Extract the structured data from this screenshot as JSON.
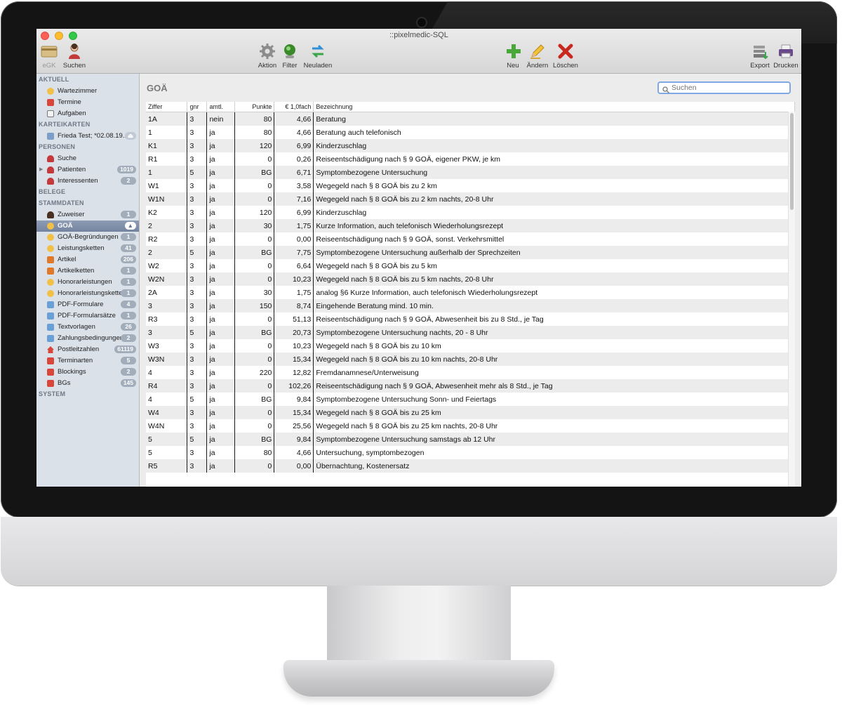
{
  "window": {
    "title": "::pixelmedic-SQL"
  },
  "toolbar": {
    "egk": "eGK",
    "search": "Suchen",
    "action": "Aktion",
    "filter": "Filter",
    "reload": "Neuladen",
    "new": "Neu",
    "edit": "Ändern",
    "delete": "Löschen",
    "export": "Export",
    "print": "Drucken"
  },
  "sidebar": {
    "sections": [
      "AKTUELL",
      "KARTEIKARTEN",
      "PERSONEN",
      "BELEGE",
      "STAMMDATEN",
      "SYSTEM"
    ],
    "items": [
      {
        "label": "Wartezimmer",
        "badge": ""
      },
      {
        "label": "Termine",
        "badge": ""
      },
      {
        "label": "Aufgaben",
        "badge": ""
      },
      {
        "label": "Frieda Test; *02.08.19...",
        "badge": ""
      },
      {
        "label": "Suche",
        "badge": ""
      },
      {
        "label": "Patienten",
        "badge": "1019"
      },
      {
        "label": "Interessenten",
        "badge": "2"
      },
      {
        "label": "Zuweiser",
        "badge": "1"
      },
      {
        "label": "GOÄ",
        "badge": "▲"
      },
      {
        "label": "GOÄ-Begründungen",
        "badge": "1"
      },
      {
        "label": "Leistungsketten",
        "badge": "41"
      },
      {
        "label": "Artikel",
        "badge": "206"
      },
      {
        "label": "Artikelketten",
        "badge": "1"
      },
      {
        "label": "Honorarleistungen",
        "badge": "1"
      },
      {
        "label": "Honorarleistungsketten",
        "badge": "1"
      },
      {
        "label": "PDF-Formulare",
        "badge": "4"
      },
      {
        "label": "PDF-Formularsätze",
        "badge": "1"
      },
      {
        "label": "Textvorlagen",
        "badge": "26"
      },
      {
        "label": "Zahlungsbedingungen",
        "badge": "2"
      },
      {
        "label": "Postleitzahlen",
        "badge": "61119"
      },
      {
        "label": "Terminarten",
        "badge": "5"
      },
      {
        "label": "Blockings",
        "badge": "2"
      },
      {
        "label": "BGs",
        "badge": "145"
      }
    ]
  },
  "main": {
    "title": "GOÄ",
    "search_placeholder": "Suchen",
    "columns": [
      "Ziffer",
      "gnr",
      "amtl.",
      "Punkte",
      "€ 1,0fach",
      "Bezeichnung"
    ],
    "rows": [
      [
        "1A",
        "3",
        "nein",
        "80",
        "4,66",
        "Beratung"
      ],
      [
        "1",
        "3",
        "ja",
        "80",
        "4,66",
        "Beratung auch telefonisch"
      ],
      [
        "K1",
        "3",
        "ja",
        "120",
        "6,99",
        "Kinderzuschlag"
      ],
      [
        "R1",
        "3",
        "ja",
        "0",
        "0,26",
        "Reiseentschädigung nach § 9 GOÄ, eigener PKW, je km"
      ],
      [
        "1",
        "5",
        "ja",
        "BG",
        "6,71",
        "Symptombezogene Untersuchung"
      ],
      [
        "W1",
        "3",
        "ja",
        "0",
        "3,58",
        "Wegegeld nach § 8 GOÄ bis zu 2 km"
      ],
      [
        "W1N",
        "3",
        "ja",
        "0",
        "7,16",
        "Wegegeld nach § 8 GOÄ bis zu 2 km nachts, 20-8 Uhr"
      ],
      [
        "K2",
        "3",
        "ja",
        "120",
        "6,99",
        "Kinderzuschlag"
      ],
      [
        "2",
        "3",
        "ja",
        "30",
        "1,75",
        "Kurze Information, auch telefonisch Wiederholungsrezept"
      ],
      [
        "R2",
        "3",
        "ja",
        "0",
        "0,00",
        "Reiseentschädigung nach § 9 GOÄ, sonst. Verkehrsmittel"
      ],
      [
        "2",
        "5",
        "ja",
        "BG",
        "7,75",
        "Symptombezogene Untersuchung außerhalb der Sprechzeiten"
      ],
      [
        "W2",
        "3",
        "ja",
        "0",
        "6,64",
        "Wegegeld nach § 8 GOÄ bis zu 5 km"
      ],
      [
        "W2N",
        "3",
        "ja",
        "0",
        "10,23",
        "Wegegeld nach § 8 GOÄ bis zu 5 km nachts, 20-8 Uhr"
      ],
      [
        "2A",
        "3",
        "ja",
        "30",
        "1,75",
        "analog §6 Kurze Information, auch telefonisch Wiederholungsrezept"
      ],
      [
        "3",
        "3",
        "ja",
        "150",
        "8,74",
        "Eingehende Beratung mind. 10 min."
      ],
      [
        "R3",
        "3",
        "ja",
        "0",
        "51,13",
        "Reiseentschädigung nach § 9 GOÄ, Abwesenheit bis zu 8 Std., je Tag"
      ],
      [
        "3",
        "5",
        "ja",
        "BG",
        "20,73",
        "Symptombezogene Untersuchung nachts, 20 - 8 Uhr"
      ],
      [
        "W3",
        "3",
        "ja",
        "0",
        "10,23",
        "Wegegeld nach § 8 GOÄ bis zu 10 km"
      ],
      [
        "W3N",
        "3",
        "ja",
        "0",
        "15,34",
        "Wegegeld nach § 8 GOÄ bis zu 10 km nachts, 20-8 Uhr"
      ],
      [
        "4",
        "3",
        "ja",
        "220",
        "12,82",
        "Fremdanamnese/Unterweisung"
      ],
      [
        "R4",
        "3",
        "ja",
        "0",
        "102,26",
        "Reiseentschädigung nach § 9 GOÄ, Abwesenheit mehr als 8 Std., je Tag"
      ],
      [
        "4",
        "5",
        "ja",
        "BG",
        "9,84",
        "Symptombezogene Untersuchung Sonn- und Feiertags"
      ],
      [
        "W4",
        "3",
        "ja",
        "0",
        "15,34",
        "Wegegeld nach § 8 GOÄ bis zu 25 km"
      ],
      [
        "W4N",
        "3",
        "ja",
        "0",
        "25,56",
        "Wegegeld nach § 8 GOÄ bis zu 25 km nachts, 20-8 Uhr"
      ],
      [
        "5",
        "5",
        "ja",
        "BG",
        "9,84",
        "Symptombezogene Untersuchung samstags ab 12 Uhr"
      ],
      [
        "5",
        "3",
        "ja",
        "80",
        "4,66",
        "Untersuchung, symptombezogen"
      ],
      [
        "R5",
        "3",
        "ja",
        "0",
        "0,00",
        "Übernachtung, Kostenersatz"
      ]
    ]
  },
  "colors": {
    "accent": "#7fa9e5",
    "sidebar_bg": "#dbe1e9",
    "selection": "#7484a0",
    "badge": "#a2adbb"
  }
}
